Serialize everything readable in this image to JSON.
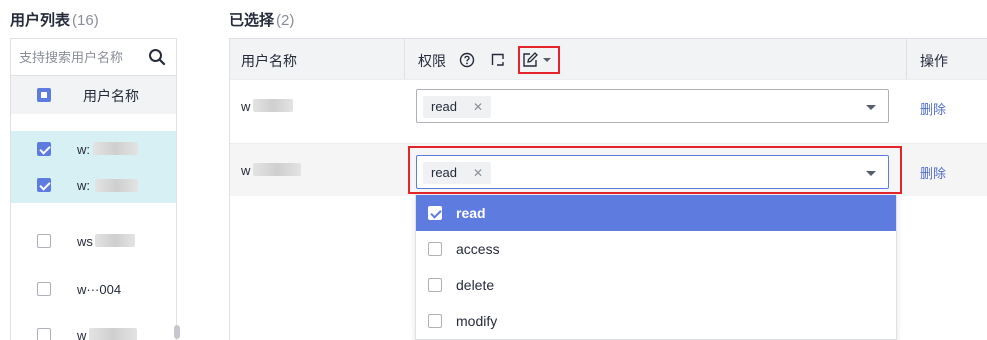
{
  "user_list": {
    "title": "用户列表",
    "count": "(16)",
    "search_placeholder": "支持搜索用户名称",
    "header_label": "用户名称",
    "rows": [
      {
        "name": "w:",
        "checked": true
      },
      {
        "name": "w:",
        "checked": true
      },
      {
        "name": "ws",
        "checked": false
      },
      {
        "name": "w···004",
        "checked": false
      },
      {
        "name": "w",
        "checked": false
      }
    ]
  },
  "selected": {
    "title": "已选择",
    "count": "(2)",
    "headers": {
      "user": "用户名称",
      "permission": "权限",
      "action": "操作"
    },
    "rows": [
      {
        "user": "w",
        "tag": "read",
        "action": "删除"
      },
      {
        "user": "w",
        "tag": "read",
        "action": "删除"
      }
    ]
  },
  "dropdown": {
    "options": [
      {
        "label": "read",
        "checked": true
      },
      {
        "label": "access",
        "checked": false
      },
      {
        "label": "delete",
        "checked": false
      },
      {
        "label": "modify",
        "checked": false
      }
    ]
  },
  "colors": {
    "accent": "#5e7ce0",
    "highlight": "#e3242b",
    "selected_row": "#d6f0f4",
    "link": "#526ecc"
  }
}
